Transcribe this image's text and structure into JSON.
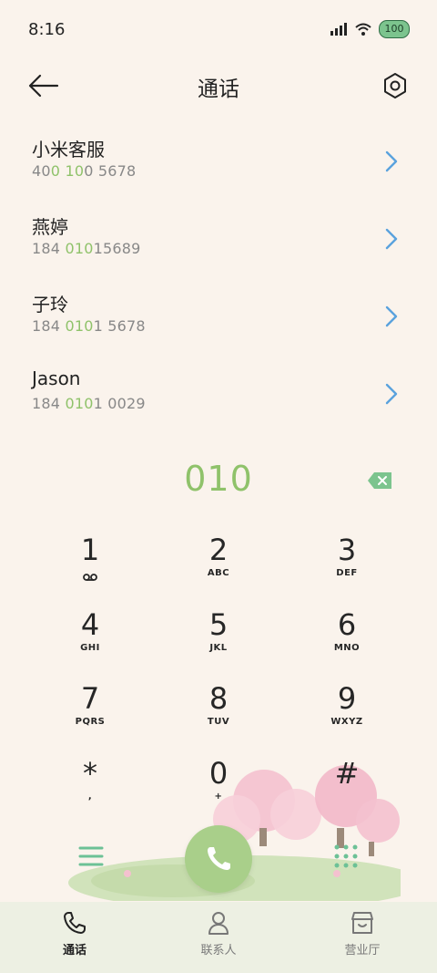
{
  "status": {
    "time": "8:16",
    "battery": "100"
  },
  "header": {
    "title": "通话"
  },
  "contacts": [
    {
      "name": "小米客服",
      "number_parts": [
        "40",
        "0",
        " ",
        "10",
        "0 5678"
      ]
    },
    {
      "name": "燕婷",
      "number_parts": [
        "184 ",
        "010",
        "15689"
      ]
    },
    {
      "name": "子玲",
      "number_parts": [
        "184 ",
        "010",
        "1 5678"
      ]
    },
    {
      "name": "Jason",
      "number_parts": [
        "184 ",
        "010",
        "1 0029"
      ]
    }
  ],
  "dialer": {
    "input": "010"
  },
  "keypad": [
    {
      "digit": "1",
      "letters": ""
    },
    {
      "digit": "2",
      "letters": "ABC"
    },
    {
      "digit": "3",
      "letters": "DEF"
    },
    {
      "digit": "4",
      "letters": "GHI"
    },
    {
      "digit": "5",
      "letters": "JKL"
    },
    {
      "digit": "6",
      "letters": "MNO"
    },
    {
      "digit": "7",
      "letters": "PQRS"
    },
    {
      "digit": "8",
      "letters": "TUV"
    },
    {
      "digit": "9",
      "letters": "WXYZ"
    },
    {
      "digit": "*",
      "letters": ","
    },
    {
      "digit": "0",
      "letters": "+"
    },
    {
      "digit": "#",
      "letters": ""
    }
  ],
  "bottom_nav": [
    {
      "label": "通话",
      "icon": "phone-icon",
      "active": true
    },
    {
      "label": "联系人",
      "icon": "person-icon",
      "active": false
    },
    {
      "label": "营业厅",
      "icon": "store-icon",
      "active": false
    }
  ],
  "colors": {
    "background": "#faf3ec",
    "accent_green": "#8fc26a",
    "chevron_blue": "#5aa2dd",
    "call_button": "#a9cf8a"
  }
}
